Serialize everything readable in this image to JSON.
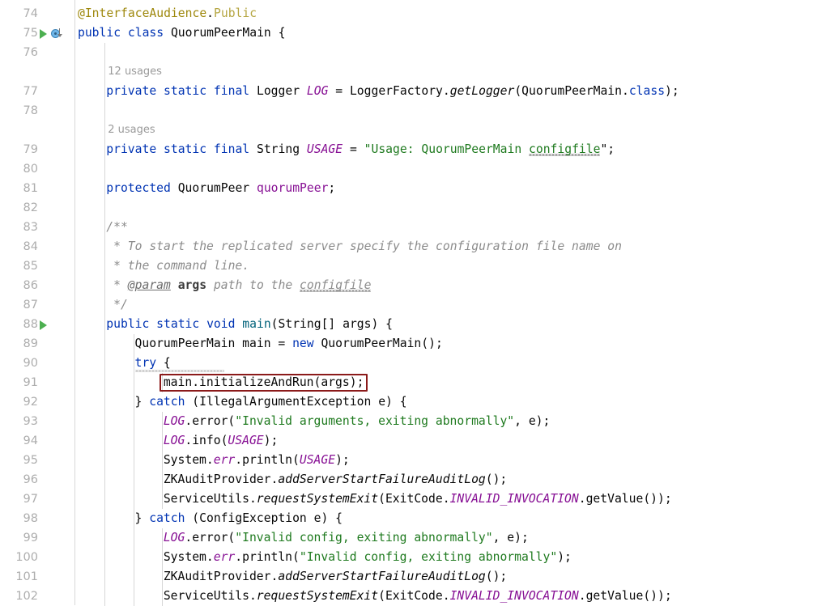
{
  "editor": {
    "app": "code-editor",
    "language": "java",
    "first_line": 74,
    "last_line": 102,
    "line_height": 24,
    "colors": {
      "background": "#ffffff",
      "keyword": "#0033b3",
      "string": "#1f7a1f",
      "constant": "#871094",
      "annotation": "#9e880d",
      "comment": "#8c8c8c",
      "method": "#00627a",
      "line_number": "#adadad",
      "highlight_box_border": "#8b1a1a",
      "gutter_separator": "#d8d8d8",
      "indent_guide": "#d6d6d6"
    }
  },
  "gutter": {
    "line_numbers": [
      "74",
      "75",
      "76",
      "77",
      "78",
      "79",
      "80",
      "81",
      "82",
      "83",
      "84",
      "85",
      "86",
      "87",
      "88",
      "89",
      "90",
      "91",
      "92",
      "93",
      "94",
      "95",
      "96",
      "97",
      "98",
      "99",
      "100",
      "101",
      "102"
    ],
    "markers": [
      {
        "line": "75",
        "icons": [
          "run-icon",
          "implemented-by-icon"
        ]
      },
      {
        "line": "88",
        "icons": [
          "run-icon"
        ]
      }
    ]
  },
  "inlay_hints": [
    {
      "line": "77",
      "text": "12 usages"
    },
    {
      "line": "79",
      "text": "2 usages"
    }
  ],
  "highlight": {
    "line": "91",
    "text": "main.initializeAndRun(args);",
    "border_color": "#8b1a1a"
  },
  "code_lines": [
    {
      "num": "74",
      "text": "@InterfaceAudience.Public"
    },
    {
      "num": "75",
      "text": "public class QuorumPeerMain {"
    },
    {
      "num": "76",
      "text": ""
    },
    {
      "num": "77",
      "text": "    private static final Logger LOG = LoggerFactory.getLogger(QuorumPeerMain.class);"
    },
    {
      "num": "78",
      "text": ""
    },
    {
      "num": "79",
      "text": "    private static final String USAGE = \"Usage: QuorumPeerMain configfile\";"
    },
    {
      "num": "80",
      "text": ""
    },
    {
      "num": "81",
      "text": "    protected QuorumPeer quorumPeer;"
    },
    {
      "num": "82",
      "text": ""
    },
    {
      "num": "83",
      "text": "    /**"
    },
    {
      "num": "84",
      "text": "     * To start the replicated server specify the configuration file name on"
    },
    {
      "num": "85",
      "text": "     * the command line."
    },
    {
      "num": "86",
      "text": "     * @param args path to the configfile"
    },
    {
      "num": "87",
      "text": "     */"
    },
    {
      "num": "88",
      "text": "    public static void main(String[] args) {"
    },
    {
      "num": "89",
      "text": "        QuorumPeerMain main = new QuorumPeerMain();"
    },
    {
      "num": "90",
      "text": "        try {"
    },
    {
      "num": "91",
      "text": "            main.initializeAndRun(args);"
    },
    {
      "num": "92",
      "text": "        } catch (IllegalArgumentException e) {"
    },
    {
      "num": "93",
      "text": "            LOG.error(\"Invalid arguments, exiting abnormally\", e);"
    },
    {
      "num": "94",
      "text": "            LOG.info(USAGE);"
    },
    {
      "num": "95",
      "text": "            System.err.println(USAGE);"
    },
    {
      "num": "96",
      "text": "            ZKAuditProvider.addServerStartFailureAuditLog();"
    },
    {
      "num": "97",
      "text": "            ServiceUtils.requestSystemExit(ExitCode.INVALID_INVOCATION.getValue());"
    },
    {
      "num": "98",
      "text": "        } catch (ConfigException e) {"
    },
    {
      "num": "99",
      "text": "            LOG.error(\"Invalid config, exiting abnormally\", e);"
    },
    {
      "num": "100",
      "text": "            System.err.println(\"Invalid config, exiting abnormally\");"
    },
    {
      "num": "101",
      "text": "            ZKAuditProvider.addServerStartFailureAuditLog();"
    },
    {
      "num": "102",
      "text": "            ServiceUtils.requestSystemExit(ExitCode.INVALID_INVOCATION.getValue());"
    }
  ],
  "tokens": {
    "l74": [
      [
        "@InterfaceAudience",
        "anno"
      ],
      [
        ".",
        "plain"
      ],
      [
        "Public",
        "anno2"
      ]
    ],
    "l75": [
      [
        "public",
        "kw"
      ],
      [
        " ",
        "plain"
      ],
      [
        "class",
        "kw"
      ],
      [
        " QuorumPeerMain {",
        "plain"
      ]
    ],
    "l77": [
      [
        "private",
        "kw"
      ],
      [
        " ",
        "plain"
      ],
      [
        "static",
        "kw"
      ],
      [
        " ",
        "plain"
      ],
      [
        "final",
        "kw"
      ],
      [
        " Logger ",
        "plain"
      ],
      [
        "LOG",
        "cnst"
      ],
      [
        " = LoggerFactory.",
        "plain"
      ],
      [
        "getLogger",
        "smeth"
      ],
      [
        "(QuorumPeerMain.",
        "plain"
      ],
      [
        "class",
        "kw"
      ],
      [
        ");",
        "plain"
      ]
    ],
    "l79": [
      [
        "private",
        "kw"
      ],
      [
        " ",
        "plain"
      ],
      [
        "static",
        "kw"
      ],
      [
        " ",
        "plain"
      ],
      [
        "final",
        "kw"
      ],
      [
        " String ",
        "plain"
      ],
      [
        "USAGE",
        "cnst"
      ],
      [
        " = ",
        "plain"
      ],
      [
        "\"Usage: QuorumPeerMain ",
        "str"
      ],
      [
        "configfile",
        "str typo"
      ],
      [
        "\";",
        "plain"
      ]
    ],
    "l81": [
      [
        "protected",
        "kw"
      ],
      [
        " QuorumPeer ",
        "plain"
      ],
      [
        "quorumPeer",
        "fld"
      ],
      [
        ";",
        "plain"
      ]
    ],
    "l88": [
      [
        "public",
        "kw"
      ],
      [
        " ",
        "plain"
      ],
      [
        "static",
        "kw"
      ],
      [
        " ",
        "plain"
      ],
      [
        "void",
        "kw"
      ],
      [
        " ",
        "plain"
      ],
      [
        "main",
        "meth"
      ],
      [
        "(String[] args) {",
        "plain"
      ]
    ],
    "l89": [
      [
        "QuorumPeerMain main = ",
        "plain"
      ],
      [
        "new",
        "kw"
      ],
      [
        " QuorumPeerMain();",
        "plain"
      ]
    ],
    "l90": [
      [
        "try",
        "kw"
      ],
      [
        " {",
        "plain"
      ]
    ],
    "l91": [
      [
        "main.initializeAndRun(args);",
        "plain"
      ]
    ],
    "l92": [
      [
        "} ",
        "plain"
      ],
      [
        "catch",
        "kw"
      ],
      [
        " (IllegalArgumentException e) {",
        "plain"
      ]
    ],
    "l93": [
      [
        "LOG",
        "cnst"
      ],
      [
        ".error(",
        "plain"
      ],
      [
        "\"Invalid arguments, exiting abnormally\"",
        "str"
      ],
      [
        ", e);",
        "plain"
      ]
    ],
    "l94": [
      [
        "LOG",
        "cnst"
      ],
      [
        ".info(",
        "plain"
      ],
      [
        "USAGE",
        "cnst"
      ],
      [
        ");",
        "plain"
      ]
    ],
    "l95": [
      [
        "System.",
        "plain"
      ],
      [
        "err",
        "cnst"
      ],
      [
        ".println(",
        "plain"
      ],
      [
        "USAGE",
        "cnst"
      ],
      [
        ");",
        "plain"
      ]
    ],
    "l96": [
      [
        "ZKAuditProvider.",
        "plain"
      ],
      [
        "addServerStartFailureAuditLog",
        "smeth"
      ],
      [
        "();",
        "plain"
      ]
    ],
    "l97": [
      [
        "ServiceUtils.",
        "plain"
      ],
      [
        "requestSystemExit",
        "smeth"
      ],
      [
        "(ExitCode.",
        "plain"
      ],
      [
        "INVALID_INVOCATION",
        "cnst"
      ],
      [
        ".getValue());",
        "plain"
      ]
    ],
    "l98": [
      [
        "} ",
        "plain"
      ],
      [
        "catch",
        "kw"
      ],
      [
        " (ConfigException e) {",
        "plain"
      ]
    ],
    "l99": [
      [
        "LOG",
        "cnst"
      ],
      [
        ".error(",
        "plain"
      ],
      [
        "\"Invalid config, exiting abnormally\"",
        "str"
      ],
      [
        ", e);",
        "plain"
      ]
    ],
    "l100": [
      [
        "System.",
        "plain"
      ],
      [
        "err",
        "cnst"
      ],
      [
        ".println(",
        "plain"
      ],
      [
        "\"Invalid config, exiting abnormally\"",
        "str"
      ],
      [
        ");",
        "plain"
      ]
    ],
    "l101": [
      [
        "ZKAuditProvider.",
        "plain"
      ],
      [
        "addServerStartFailureAuditLog",
        "smeth"
      ],
      [
        "();",
        "plain"
      ]
    ],
    "l102": [
      [
        "ServiceUtils.",
        "plain"
      ],
      [
        "requestSystemExit",
        "smeth"
      ],
      [
        "(ExitCode.",
        "plain"
      ],
      [
        "INVALID_INVOCATION",
        "cnst"
      ],
      [
        ".getValue());",
        "plain"
      ]
    ],
    "l83": [
      [
        "/**",
        "doc"
      ]
    ],
    "l84": [
      [
        " * To start the replicated server specify the configuration file name on",
        "doc"
      ]
    ],
    "l85": [
      [
        " * the command line.",
        "doc"
      ]
    ],
    "l86_pre": [
      [
        " * ",
        "doc"
      ]
    ],
    "l86_tag": "@param",
    "l86_arg": "args",
    "l86_post": " path to the ",
    "l86_typo": "configfile",
    "l87": [
      [
        " */",
        "doc"
      ]
    ]
  }
}
